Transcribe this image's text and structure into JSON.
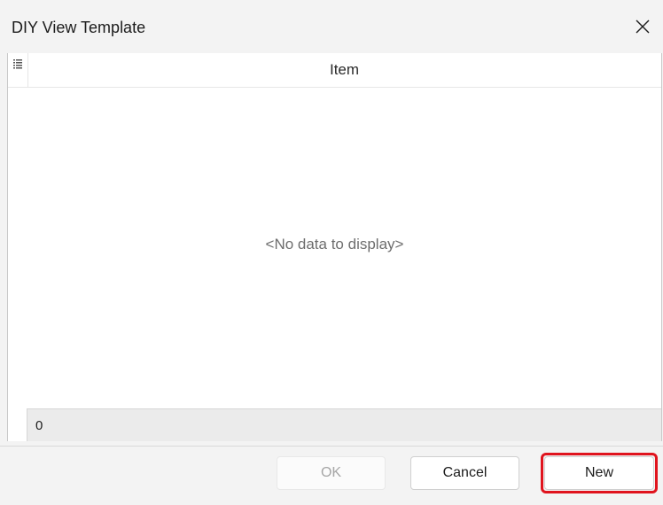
{
  "window": {
    "title": "DIY View Template"
  },
  "grid": {
    "column_header": "Item",
    "empty_message": "<No data to display>",
    "footer_count": "0"
  },
  "buttons": {
    "ok_label": "OK",
    "cancel_label": "Cancel",
    "new_label": "New"
  },
  "icons": {
    "close": "close-icon",
    "column_chooser": "column-chooser-icon"
  },
  "colors": {
    "highlight": "#e0141e"
  }
}
